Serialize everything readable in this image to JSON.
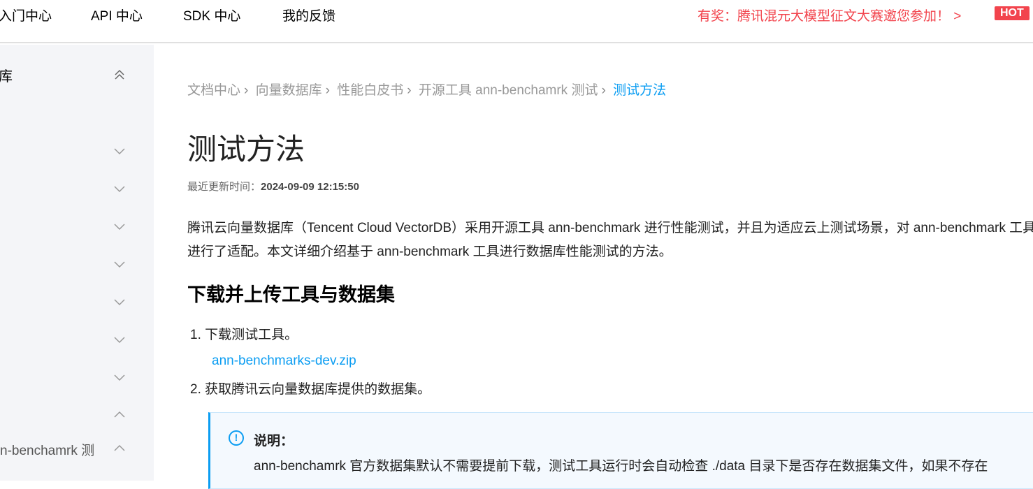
{
  "topnav": {
    "items": [
      "入门中心",
      "API 中心",
      "SDK 中心",
      "我的反馈"
    ],
    "promo": "有奖：腾讯混元大模型征文大赛邀您参加！ >",
    "hot": "HOT"
  },
  "sidebar": {
    "title": "库",
    "last_item": "n-benchamrk 测"
  },
  "breadcrumb": [
    "文档中心",
    "向量数据库",
    "性能白皮书",
    "开源工具 ann-benchamrk 测试",
    "测试方法"
  ],
  "page": {
    "title": "测试方法",
    "updated_label": "最近更新时间：",
    "updated": "2024-09-09 12:15:50",
    "intro": "腾讯云向量数据库（Tencent Cloud VectorDB）采用开源工具 ann-benchmark 进行性能测试，并且为适应云上测试场景，对 ann-benchmark 工具进行了适配。本文详细介绍基于 ann-benchmark 工具进行数据库性能测试的方法。",
    "section": "下载并上传工具与数据集",
    "steps": [
      "1.  下载测试工具。",
      "2.  获取腾讯云向量数据库提供的数据集。"
    ],
    "download_link": "ann-benchmarks-dev.zip",
    "note": {
      "title": "说明：",
      "body": "ann-benchamrk 官方数据集默认不需要提前下载，测试工具运行时会自动检查 ./data 目录下是否存在数据集文件，如果不存在"
    }
  }
}
